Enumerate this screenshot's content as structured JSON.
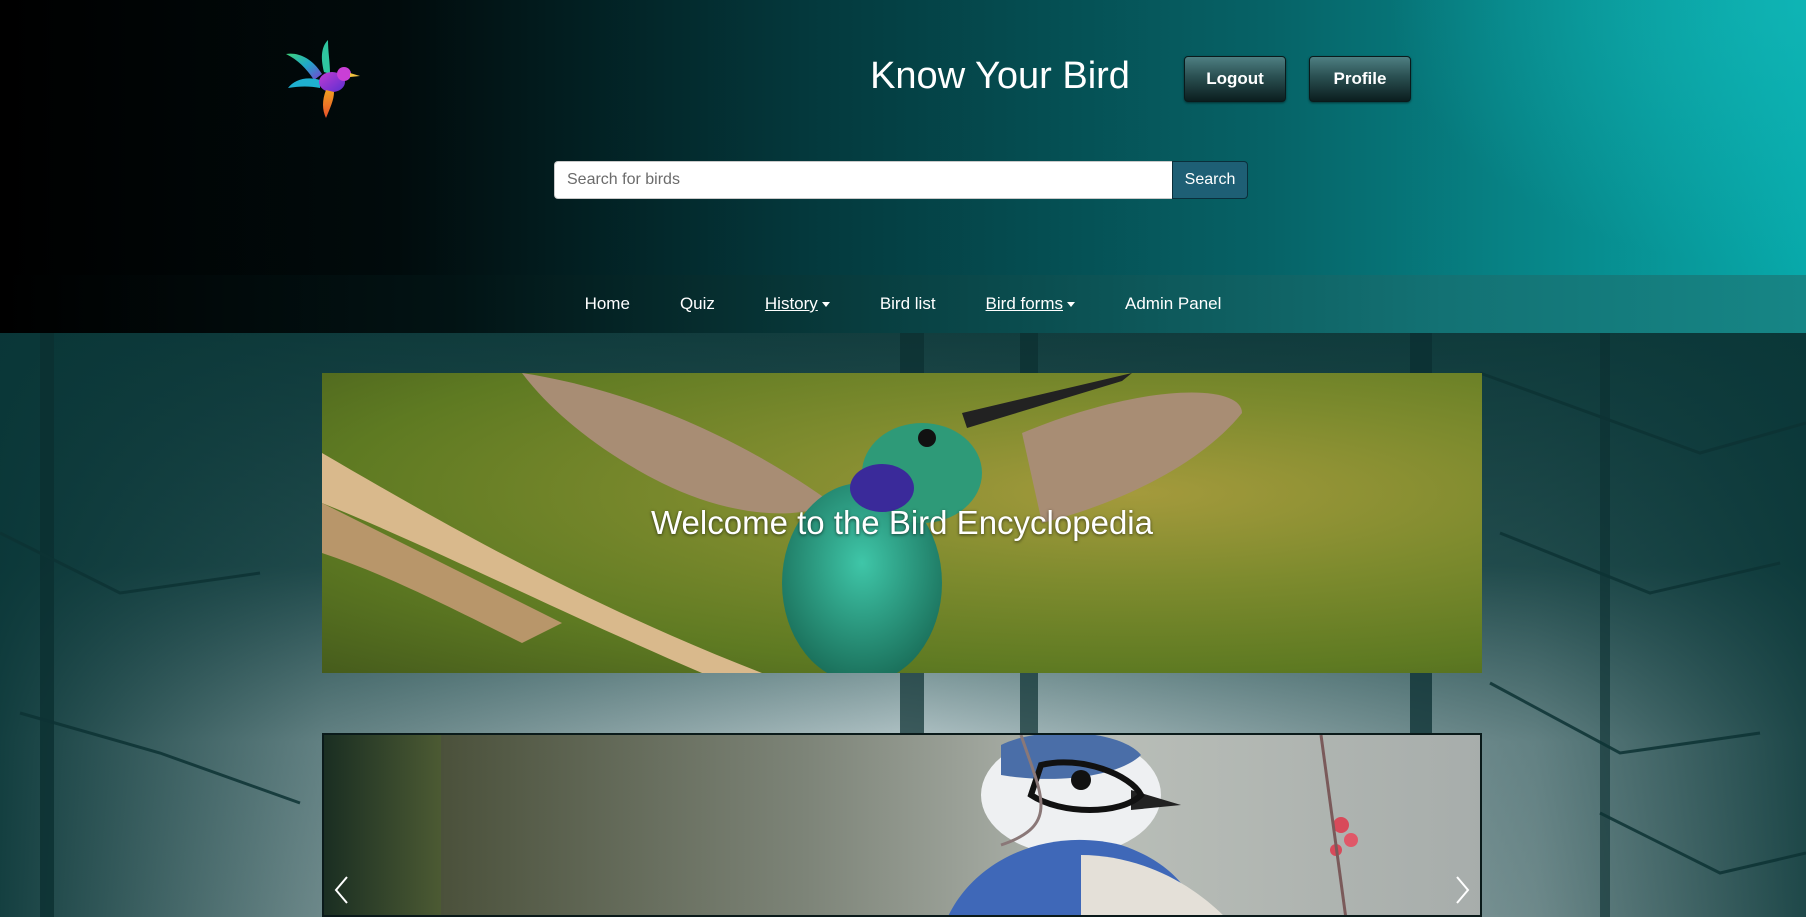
{
  "header": {
    "title": "Know Your Bird",
    "logout_label": "Logout",
    "profile_label": "Profile"
  },
  "search": {
    "placeholder": "Search for birds",
    "value": "",
    "button_label": "Search"
  },
  "nav": {
    "items": [
      {
        "label": "Home"
      },
      {
        "label": "Quiz"
      },
      {
        "label": "History"
      },
      {
        "label": "Bird list"
      },
      {
        "label": "Bird forms"
      },
      {
        "label": "Admin Panel"
      }
    ]
  },
  "hero": {
    "text": "Welcome to the Bird Encyclopedia"
  },
  "carousel": {
    "prev_icon": "chevron-left-icon",
    "next_icon": "chevron-right-icon"
  },
  "colors": {
    "search_button": "#1e5f75",
    "header_dark": "#000000",
    "header_teal": "#08a9aa"
  }
}
